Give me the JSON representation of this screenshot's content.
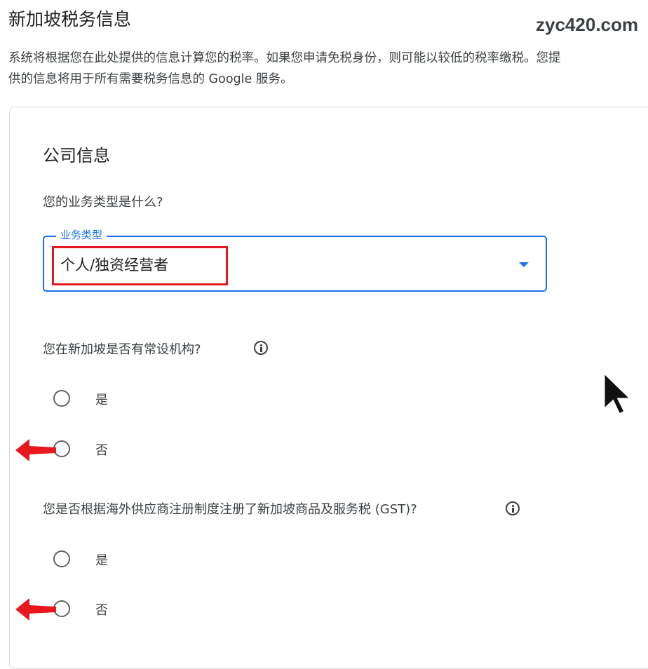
{
  "header": {
    "title": "新加坡税务信息",
    "watermark": "zyc420.com",
    "description": "系统将根据您在此处提供的信息计算您的税率。如果您申请免税身份，则可能以较低的税率缴税。您提供的信息将用于所有需要税务信息的 Google 服务。"
  },
  "card": {
    "section_title": "公司信息",
    "business_type": {
      "question": "您的业务类型是什么?",
      "field_label": "业务类型",
      "selected_value": "个人/独资经营者"
    },
    "permanent_establishment": {
      "question": "您在新加坡是否有常设机构?",
      "options": [
        {
          "label": "是",
          "selected": false
        },
        {
          "label": "否",
          "selected": false
        }
      ]
    },
    "gst_registration": {
      "question": "您是否根据海外供应商注册制度注册了新加坡商品及服务税 (GST)?",
      "options": [
        {
          "label": "是",
          "selected": false
        },
        {
          "label": "否",
          "selected": false
        }
      ]
    }
  },
  "colors": {
    "accent": "#1a73e8",
    "annotation_red": "#e8191e",
    "text": "#202124",
    "border": "#dadce0"
  },
  "icons": [
    "info-icon",
    "chevron-down-icon",
    "red-arrow-annotation",
    "mouse-cursor-icon"
  ]
}
